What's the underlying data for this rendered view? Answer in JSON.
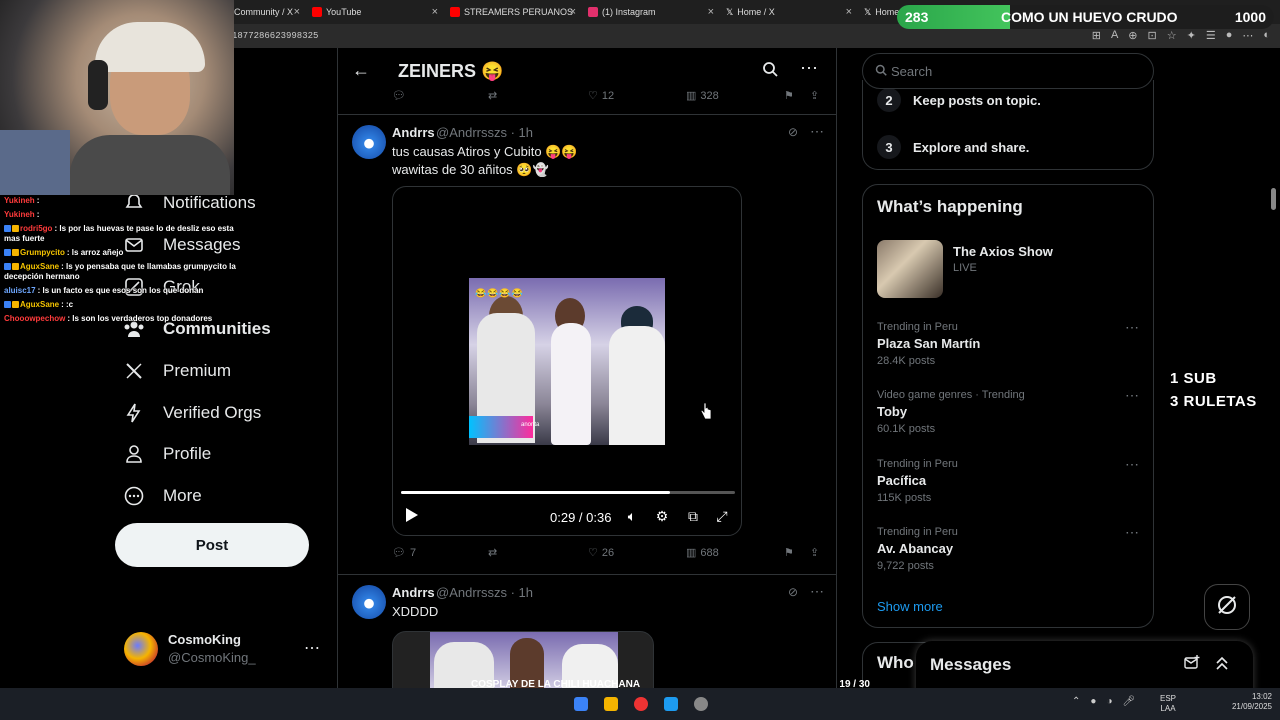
{
  "browser": {
    "tabs": [
      {
        "label": "Community / X",
        "color": "#ffffff"
      },
      {
        "label": "YouTube",
        "color": "#ff0000"
      },
      {
        "label": "STREAMERS PERUANOS",
        "color": "#ff0000"
      },
      {
        "label": "(1) Instagram",
        "color": "#e1306c"
      },
      {
        "label": "Home / X",
        "color": "#ffffff"
      },
      {
        "label": "Home",
        "color": "#ffffff"
      }
    ],
    "url": "1877286623998325"
  },
  "stream_overlay": {
    "left_count": "283",
    "title": "COMO UN HUEVO CRUDO",
    "right_count": "1000",
    "sub_line1": "1 SUB",
    "sub_line2": "3 RULETAS",
    "goal_title": "COSPLAY DE LA CHILI HUACHANA",
    "goal_count": "19 / 30",
    "goal_progress": 0.6333
  },
  "chat": [
    {
      "user": "Yukineh",
      "msg": "",
      "color": "#ff3b3b"
    },
    {
      "user": "Yukineh",
      "msg": "",
      "color": "#ff3b3b"
    },
    {
      "user": "rodri5go",
      "msg": "ls por las huevas te pase lo de desliz eso esta mas fuerte",
      "color": "#ff3b3b"
    },
    {
      "user": "Grumpycito",
      "msg": "ls arroz añejo",
      "color": "#f5c400"
    },
    {
      "user": "AguxSane",
      "msg": "ls yo pensaba que te llamabas grumpycito la decepción hermano",
      "color": "#f5c400"
    },
    {
      "user": "aluisc17",
      "msg": "ls un facto es que esos son los que donan",
      "color": "#6fa8ff"
    },
    {
      "user": "AguxSane",
      "msg": ":c",
      "color": "#f5c400"
    },
    {
      "user": "Chooowpechow",
      "msg": "ls son los verdaderos top donadores",
      "color": "#ff3b3b"
    }
  ],
  "nav": {
    "items": [
      {
        "label": "Notifications",
        "icon": "bell-icon"
      },
      {
        "label": "Messages",
        "icon": "envelope-icon"
      },
      {
        "label": "Grok",
        "icon": "grok-icon"
      },
      {
        "label": "Communities",
        "icon": "communities-icon"
      },
      {
        "label": "Premium",
        "icon": "x-logo-icon"
      },
      {
        "label": "Verified Orgs",
        "icon": "lightning-icon"
      },
      {
        "label": "Profile",
        "icon": "person-icon"
      },
      {
        "label": "More",
        "icon": "more-circle-icon"
      }
    ],
    "post_label": "Post",
    "user_name": "CosmoKing",
    "user_handle": "@CosmoKing_"
  },
  "main": {
    "title": "ZEINERS 😝",
    "top_actions": {
      "replies": "",
      "reposts": "",
      "likes": "12",
      "views": "328"
    },
    "tweet1": {
      "name": "Andrrs",
      "handle": "@Andrrsszs · 1h",
      "line1": "tus causas Atiros y Cubito 😝😝",
      "line2": "wawitas de 30 añitos 🥺👻",
      "video_caption": "anorita",
      "video_emojis": "😂😂😂😂",
      "time": "0:29 / 0:36",
      "progress": 0.8056,
      "actions": {
        "replies": "7",
        "reposts": "",
        "likes": "26",
        "views": "688"
      }
    },
    "tweet2": {
      "name": "Andrrs",
      "handle": "@Andrrsszs · 1h",
      "text": "XDDDD"
    }
  },
  "right": {
    "search_placeholder": "Search",
    "rules": [
      {
        "n": "2",
        "text": "Keep posts on topic."
      },
      {
        "n": "3",
        "text": "Explore and share."
      }
    ],
    "happening_title": "What’s happening",
    "live": {
      "name": "The Axios Show",
      "status": "LIVE"
    },
    "trends": [
      {
        "context": "Trending in Peru",
        "name": "Plaza San Martín",
        "posts": "28.4K posts"
      },
      {
        "context": "Video game genres · Trending",
        "name": "Toby",
        "posts": "60.1K posts"
      },
      {
        "context": "Trending in Peru",
        "name": "Pacífica",
        "posts": "115K posts"
      },
      {
        "context": "Trending in Peru",
        "name": "Av. Abancay",
        "posts": "9,722 posts"
      }
    ],
    "show_more": "Show more",
    "who_title": "Who",
    "messages_title": "Messages"
  },
  "taskbar": {
    "lang1": "ESP",
    "lang2": "LAA",
    "time": "13:02",
    "date": "21/09/2025"
  },
  "colors": {
    "accent": "#1d9bf0",
    "goal_green": "#2fd45a"
  }
}
